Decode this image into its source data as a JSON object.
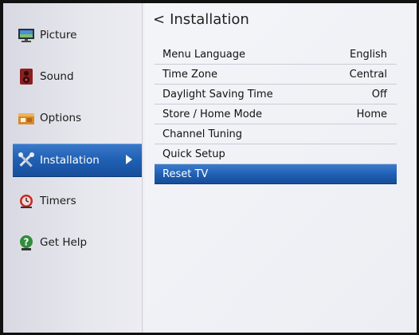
{
  "sidebar": {
    "items": [
      {
        "label": "Picture"
      },
      {
        "label": "Sound"
      },
      {
        "label": "Options"
      },
      {
        "label": "Installation"
      },
      {
        "label": "Timers"
      },
      {
        "label": "Get Help"
      }
    ]
  },
  "main": {
    "back_glyph": "<",
    "title": "Installation",
    "rows": [
      {
        "label": "Menu Language",
        "value": "English"
      },
      {
        "label": "Time Zone",
        "value": "Central"
      },
      {
        "label": "Daylight Saving Time",
        "value": "Off"
      },
      {
        "label": "Store / Home Mode",
        "value": "Home"
      },
      {
        "label": "Channel Tuning",
        "value": ""
      },
      {
        "label": "Quick Setup",
        "value": ""
      },
      {
        "label": "Reset TV",
        "value": ""
      }
    ]
  },
  "colors": {
    "selection": "#1f5fb3",
    "background": "#eef0f4"
  }
}
